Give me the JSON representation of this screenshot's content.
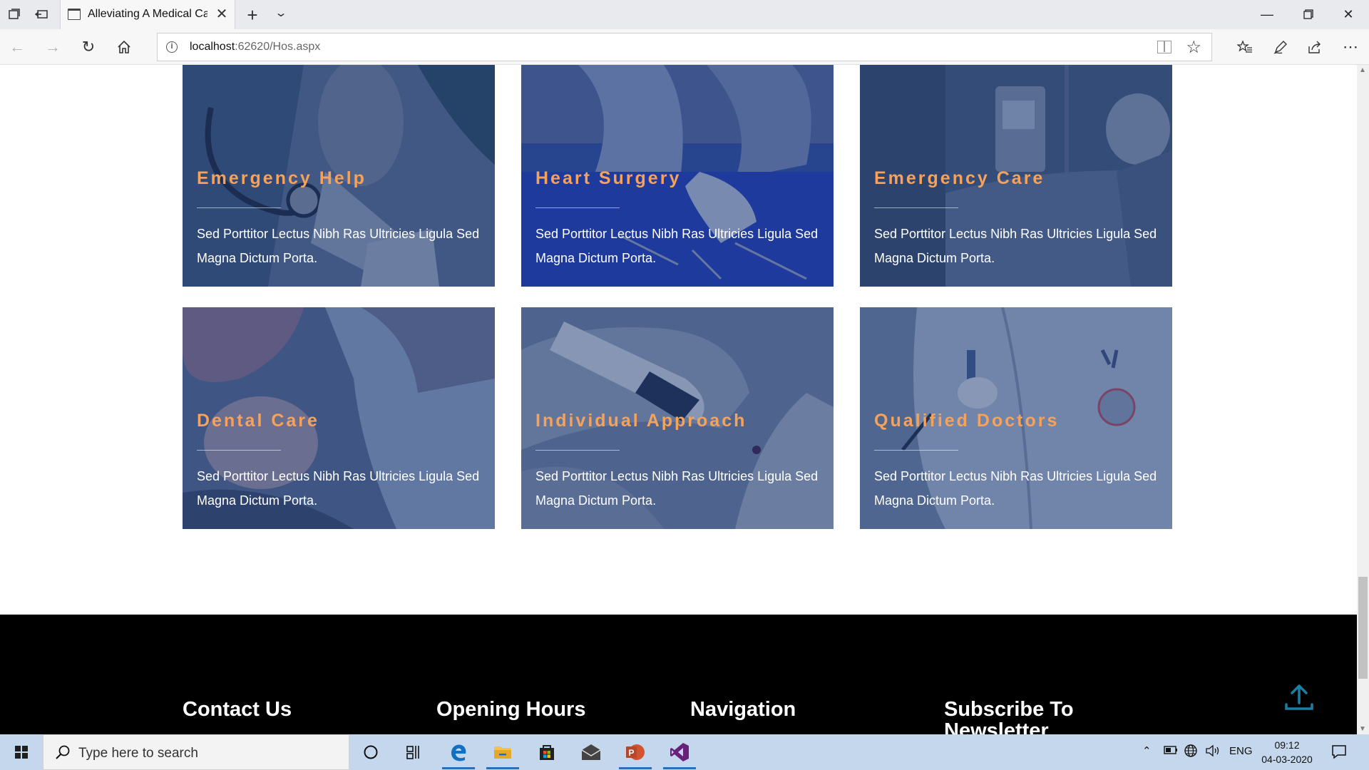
{
  "browser": {
    "tab_title": "Alleviating A Medical Ca",
    "url_host": "localhost",
    "url_rest": ":62620/Hos.aspx"
  },
  "cards": [
    {
      "title": "Emergency Help",
      "text": "Sed Porttitor Lectus Nibh Ras Ultricies Ligula Sed Magna Dictum Porta.",
      "image": "stethoscope-hands-photo"
    },
    {
      "title": "Heart Surgery",
      "text": "Sed Porttitor Lectus Nibh Ras Ultricies Ligula Sed Magna Dictum Porta.",
      "image": "operating-room-photo"
    },
    {
      "title": "Emergency Care",
      "text": "Sed Porttitor Lectus Nibh Ras Ultricies Ligula Sed Magna Dictum Porta.",
      "image": "hospital-bed-photo"
    },
    {
      "title": "Dental Care",
      "text": "Sed Porttitor Lectus Nibh Ras Ultricies Ligula Sed Magna Dictum Porta.",
      "image": "dentist-patient-photo"
    },
    {
      "title": "Individual Approach",
      "text": "Sed Porttitor Lectus Nibh Ras Ultricies Ligula Sed Magna Dictum Porta.",
      "image": "glucose-meter-photo"
    },
    {
      "title": "Qualified Doctors",
      "text": "Sed Porttitor Lectus Nibh Ras Ultricies Ligula Sed Magna Dictum Porta.",
      "image": "doctor-coat-photo"
    }
  ],
  "footer": {
    "headings": [
      "Contact Us",
      "Opening Hours",
      "Navigation",
      "Subscribe To Newsletter"
    ]
  },
  "taskbar": {
    "search_placeholder": "Type here to search",
    "language": "ENG",
    "time": "09:12",
    "date": "04-03-2020"
  },
  "colors": {
    "card_title": "#f5a25d",
    "card_overlay": "#1f3c7a",
    "footer_bg": "#000000",
    "accent_teal": "#1b7fa3"
  },
  "icons": {
    "back": "arrow-left-icon",
    "forward": "arrow-right-icon",
    "refresh": "refresh-icon",
    "home": "home-icon",
    "favorite": "star-icon",
    "scroll_top": "upload-arrow-icon"
  }
}
